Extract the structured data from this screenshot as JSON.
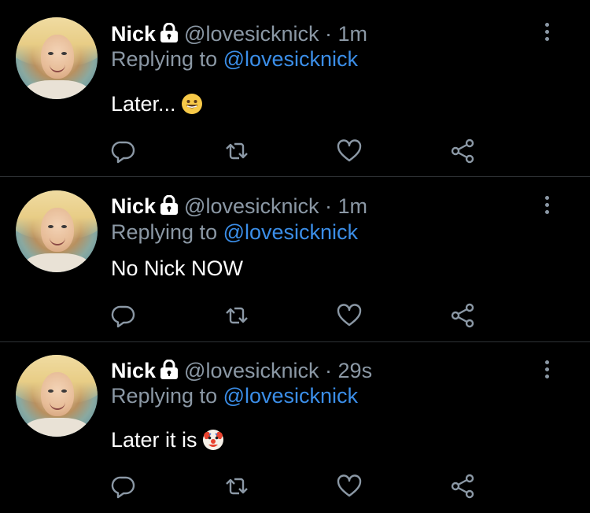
{
  "tweets": [
    {
      "name": "Nick",
      "handle": "@lovesicknick",
      "dot": "·",
      "time": "1m",
      "reply_prefix": "Replying to ",
      "reply_mention": "@lovesicknick",
      "text": "Later...",
      "emoji": "grinning-face"
    },
    {
      "name": "Nick",
      "handle": "@lovesicknick",
      "dot": "·",
      "time": "1m",
      "reply_prefix": "Replying to ",
      "reply_mention": "@lovesicknick",
      "text": "No Nick NOW",
      "emoji": ""
    },
    {
      "name": "Nick",
      "handle": "@lovesicknick",
      "dot": "·",
      "time": "29s",
      "reply_prefix": "Replying to ",
      "reply_mention": "@lovesicknick",
      "text": "Later it is",
      "emoji": "clown-face"
    }
  ],
  "icons": {
    "reply": "reply-icon",
    "retweet": "retweet-icon",
    "like": "like-icon",
    "share": "share-icon",
    "more": "more-icon",
    "lock": "lock-icon"
  },
  "colors": {
    "background": "#000000",
    "text": "#ffffff",
    "secondary": "#8b98a5",
    "mention": "#3b8ee8",
    "divider": "#2f3336"
  }
}
